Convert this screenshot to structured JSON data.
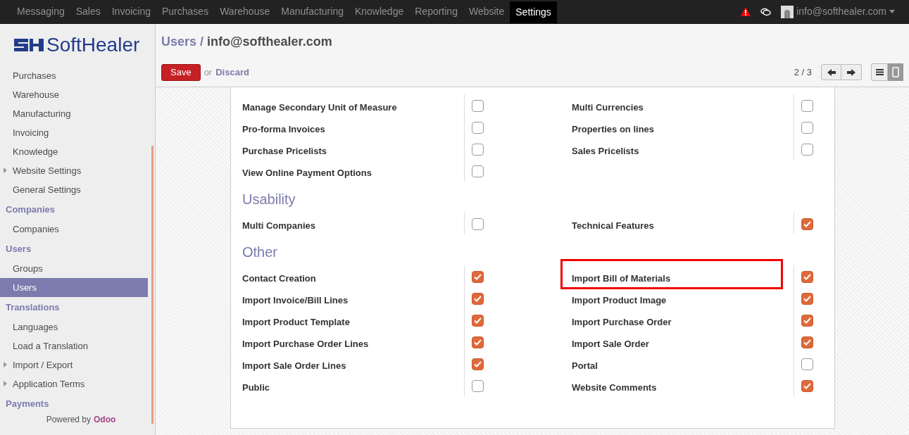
{
  "top_menu": [
    {
      "label": "Messaging",
      "selected": false
    },
    {
      "label": "Sales",
      "selected": false
    },
    {
      "label": "Invoicing",
      "selected": false
    },
    {
      "label": "Purchases",
      "selected": false
    },
    {
      "label": "Warehouse",
      "selected": false
    },
    {
      "label": "Manufacturing",
      "selected": false
    },
    {
      "label": "Knowledge",
      "selected": false
    },
    {
      "label": "Reporting",
      "selected": false
    },
    {
      "label": "Website",
      "selected": false
    },
    {
      "label": "Settings",
      "selected": true
    }
  ],
  "user": {
    "email": "info@softhealer.com"
  },
  "logo": {
    "text": "SoftHealer"
  },
  "sidebar": [
    {
      "kind": "item",
      "label": "Purchases",
      "expandable": false,
      "selected": false
    },
    {
      "kind": "item",
      "label": "Warehouse",
      "expandable": false,
      "selected": false
    },
    {
      "kind": "item",
      "label": "Manufacturing",
      "expandable": false,
      "selected": false
    },
    {
      "kind": "item",
      "label": "Invoicing",
      "expandable": false,
      "selected": false
    },
    {
      "kind": "item",
      "label": "Knowledge",
      "expandable": false,
      "selected": false
    },
    {
      "kind": "item",
      "label": "Website Settings",
      "expandable": true,
      "selected": false
    },
    {
      "kind": "item",
      "label": "General Settings",
      "expandable": false,
      "selected": false
    },
    {
      "kind": "heading",
      "label": "Companies"
    },
    {
      "kind": "item",
      "label": "Companies",
      "expandable": false,
      "selected": false
    },
    {
      "kind": "heading",
      "label": "Users"
    },
    {
      "kind": "item",
      "label": "Groups",
      "expandable": false,
      "selected": false
    },
    {
      "kind": "item",
      "label": "Users",
      "expandable": false,
      "selected": true
    },
    {
      "kind": "heading",
      "label": "Translations"
    },
    {
      "kind": "item",
      "label": "Languages",
      "expandable": false,
      "selected": false
    },
    {
      "kind": "item",
      "label": "Load a Translation",
      "expandable": false,
      "selected": false
    },
    {
      "kind": "item",
      "label": "Import / Export",
      "expandable": true,
      "selected": false
    },
    {
      "kind": "item",
      "label": "Application Terms",
      "expandable": true,
      "selected": false
    },
    {
      "kind": "heading",
      "label": "Payments"
    }
  ],
  "powered_by": {
    "prefix": "Powered by",
    "brand": "Odoo"
  },
  "breadcrumb": {
    "parent": "Users",
    "separator": "/",
    "current": "info@softhealer.com"
  },
  "actions": {
    "save": "Save",
    "or": "or",
    "discard": "Discard"
  },
  "pager": {
    "text": "2 / 3"
  },
  "sections": [
    {
      "rows": [
        [
          {
            "label": "Manage Secondary Unit of Measure",
            "checked": false,
            "highlighted": false
          },
          {
            "label": "Multi Currencies",
            "checked": false,
            "highlighted": false
          }
        ],
        [
          {
            "label": "Pro-forma Invoices",
            "checked": false,
            "highlighted": false
          },
          {
            "label": "Properties on lines",
            "checked": false,
            "highlighted": false
          }
        ],
        [
          {
            "label": "Purchase Pricelists",
            "checked": false,
            "highlighted": false
          },
          {
            "label": "Sales Pricelists",
            "checked": false,
            "highlighted": false
          }
        ],
        [
          {
            "label": "View Online Payment Options",
            "checked": false,
            "highlighted": false
          }
        ]
      ]
    },
    {
      "title": "Usability",
      "rows": [
        [
          {
            "label": "Multi Companies",
            "checked": false,
            "highlighted": false
          },
          {
            "label": "Technical Features",
            "checked": true,
            "highlighted": false
          }
        ]
      ]
    },
    {
      "title": "Other",
      "rows": [
        [
          {
            "label": "Contact Creation",
            "checked": true,
            "highlighted": false
          },
          {
            "label": "Import Bill of Materials",
            "checked": true,
            "highlighted": true
          }
        ],
        [
          {
            "label": "Import Invoice/Bill Lines",
            "checked": true,
            "highlighted": false
          },
          {
            "label": "Import Product Image",
            "checked": true,
            "highlighted": false
          }
        ],
        [
          {
            "label": "Import Product Template",
            "checked": true,
            "highlighted": false
          },
          {
            "label": "Import Purchase Order",
            "checked": true,
            "highlighted": false
          }
        ],
        [
          {
            "label": "Import Purchase Order Lines",
            "checked": true,
            "highlighted": false
          },
          {
            "label": "Import Sale Order",
            "checked": true,
            "highlighted": false
          }
        ],
        [
          {
            "label": "Import Sale Order Lines",
            "checked": true,
            "highlighted": false
          },
          {
            "label": "Portal",
            "checked": false,
            "highlighted": false
          }
        ],
        [
          {
            "label": "Public",
            "checked": false,
            "highlighted": false
          },
          {
            "label": "Website Comments",
            "checked": true,
            "highlighted": false
          }
        ]
      ]
    }
  ]
}
